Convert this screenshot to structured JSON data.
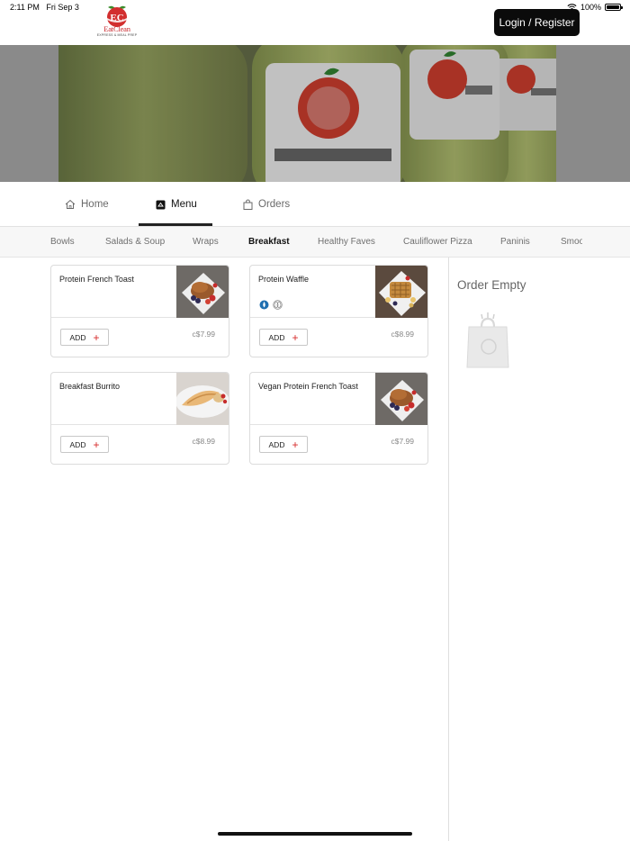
{
  "status_bar": {
    "time": "2:11 PM",
    "date": "Fri Sep 3",
    "battery": "100%",
    "battery_level": 1.0
  },
  "brand": {
    "name": "EatClean",
    "tagline": "EXPRESS & MEAL PREP",
    "monogram": "EC",
    "accent_color": "#c8262c"
  },
  "header": {
    "login_label": "Login / Register"
  },
  "nav": {
    "tabs": [
      {
        "label": "Home",
        "icon": "home-icon"
      },
      {
        "label": "Menu",
        "icon": "menu-icon"
      },
      {
        "label": "Orders",
        "icon": "bag-icon"
      }
    ],
    "active": "Menu"
  },
  "categories": {
    "items": [
      "Bowls",
      "Salads & Soup",
      "Wraps",
      "Breakfast",
      "Healthy Faves",
      "Cauliflower Pizza",
      "Paninis",
      "Smoo"
    ],
    "active": "Breakfast"
  },
  "menu_items": [
    {
      "name": "Protein French Toast",
      "add_label": "ADD",
      "price": "c$7.99",
      "badges": []
    },
    {
      "name": "Protein Waffle",
      "add_label": "ADD",
      "price": "c$8.99",
      "badges": [
        "dairy-icon",
        "nut-icon"
      ]
    },
    {
      "name": "Breakfast Burrito",
      "add_label": "ADD",
      "price": "c$8.99",
      "badges": []
    },
    {
      "name": "Vegan Protein French Toast",
      "add_label": "ADD",
      "price": "c$7.99",
      "badges": []
    }
  ],
  "order": {
    "title": "Order Empty",
    "icon": "empty-bag-icon"
  }
}
